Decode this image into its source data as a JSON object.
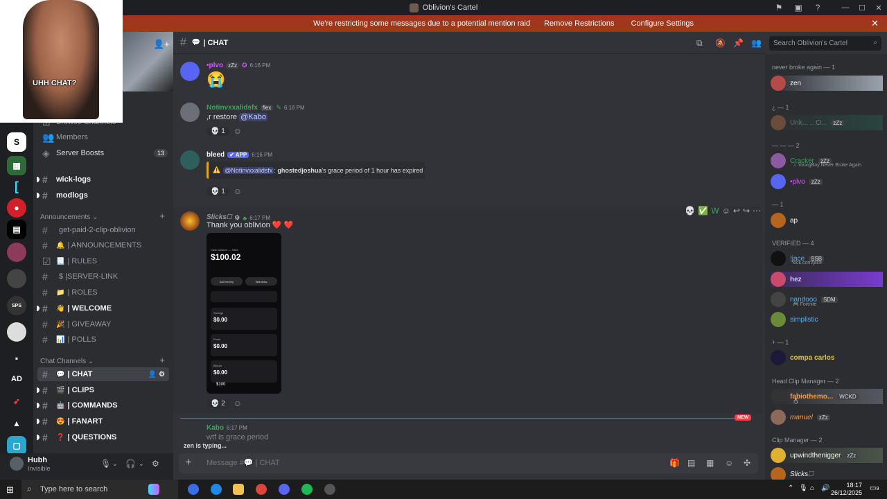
{
  "window": {
    "title": "Oblivion's Cartel"
  },
  "notice": {
    "text": "We're restricting some messages due to a potential mention raid",
    "remove_btn": "Remove Restrictions",
    "configure_btn": "Configure Settings"
  },
  "webcam": {
    "caption": "UHH CHAT?"
  },
  "sidebar": {
    "browse": "Browse Channels",
    "members": "Members",
    "boosts": "Server Boosts",
    "boosts_count": "13",
    "channels_top": [
      "wick-logs",
      "modlogs"
    ],
    "cat_announcements": "Announcements",
    "announcements": [
      {
        "icon": "",
        "label": "get-paid-2-clip-oblivion"
      },
      {
        "icon": "🔔",
        "label": "| ANNOUNCEMENTS"
      },
      {
        "icon": "📃",
        "label": "| RULES"
      },
      {
        "icon": "",
        "label": "$ |SERVER-LINK"
      },
      {
        "icon": "📁",
        "label": "| ROLES"
      },
      {
        "icon": "👋",
        "label": "| WELCOME"
      },
      {
        "icon": "🎉",
        "label": "| GIVEAWAY"
      },
      {
        "icon": "📊",
        "label": "| POLLS"
      }
    ],
    "cat_chat": "Chat Channels",
    "chat_channels": [
      {
        "icon": "💬",
        "label": "| CHAT"
      },
      {
        "icon": "🎬",
        "label": "| CLIPS"
      },
      {
        "icon": "🤖",
        "label": "| COMMANDS"
      },
      {
        "icon": "😍",
        "label": "| FANART"
      },
      {
        "icon": "❓",
        "label": "| QUESTIONS"
      }
    ]
  },
  "user": {
    "name": "Hubh",
    "status": "Invisible"
  },
  "chat": {
    "channel": "| CHAT",
    "search_placeholder": "Search Oblivion's Cartel",
    "composer_placeholder": "Message #💬 | CHAT",
    "typing": "zen is typing...",
    "new_label": "NEW",
    "messages": [
      {
        "author": "•plvo",
        "tag": "zZz",
        "time": "6:16 PM",
        "body": "😭",
        "author_color": "#d357fe"
      },
      {
        "author": "Notinvxxalidsfx",
        "tag": "flex",
        "time": "6:16 PM",
        "body_prefix": ",r restore ",
        "mention": "@Kabo",
        "reaction": "💀 1",
        "author_color": "#3ba55d"
      },
      {
        "author": "bleed",
        "app": "✔ APP",
        "time": "6:16 PM",
        "embed_icon": "⚠️",
        "embed_mention": "@Notinvxxalidsfx",
        "embed_text_a": ": ",
        "embed_user": "ghostedjoshua",
        "embed_text_b": "'s grace period of 1 hour has expired",
        "reaction": "💀 1",
        "author_color": "#f2f3f5"
      },
      {
        "author": "Slicks🗆",
        "time": "6:17 PM",
        "body": "Thank you oblivion ❤️ ❤️",
        "reaction": "💀 2",
        "author_color": "#949ba4"
      },
      {
        "author": "Kabo",
        "time": "6:17 PM",
        "body": "wtf is grace period",
        "author_color": "#3ba55d"
      }
    ],
    "phone": {
      "caption": "Cash balance — 9364",
      "balance": "$100.02",
      "add_money": "Add money",
      "withdraw": "Withdraw",
      "rows": [
        {
          "label": "Savings",
          "value": "$0.00"
        },
        {
          "label": "Pools",
          "value": "$0.00"
        },
        {
          "label": "Bitcoin",
          "value": "$0.00"
        }
      ],
      "footer": "$100"
    }
  },
  "members": {
    "groups": [
      {
        "title": "never broke again — 1"
      },
      {
        "title": "¿ — 1"
      },
      {
        "title": "— — — 2"
      },
      {
        "title": "— 1"
      },
      {
        "title": "VERIFIED — 4"
      },
      {
        "title": "+ — 1"
      },
      {
        "title": "Head Clip Manager — 2"
      },
      {
        "title": "Clip Manager — 2"
      }
    ],
    "list": [
      {
        "name": "zen",
        "color": "#f2f3f5"
      },
      {
        "name": "Unk... .. O...",
        "color": "#6d6f78"
      },
      {
        "name": "Cracker",
        "color": "#3ba55d",
        "sub": "♫ YoungBoy Never Broke Again"
      },
      {
        "name": "•plvo",
        "color": "#d357fe"
      },
      {
        "name": "ap",
        "color": "#f2f3f5"
      },
      {
        "name": "!jace",
        "color": "#5dadec",
        "sub": "kick.com/jace"
      },
      {
        "name": "hez",
        "color": "#c9cdfb"
      },
      {
        "name": "nandooo",
        "color": "#5dadec",
        "sub": "🎮 Fortnite"
      },
      {
        "name": "simplistic",
        "color": "#5dadec"
      },
      {
        "name": "compa carlos",
        "color": "#e7c24a"
      },
      {
        "name": "fabiothemo...",
        "color": "#f29a4a",
        "sub": "💍"
      },
      {
        "name": "manuel",
        "color": "#f29a4a"
      },
      {
        "name": "upwindthenigger",
        "color": "#f2f3f5"
      },
      {
        "name": "Slicks🗆",
        "color": "#f2f3f5"
      }
    ],
    "tags": {
      "wckd": "WCKD",
      "ssb": "SSB",
      "sdm": "SDM",
      "zzz": "zZz"
    }
  },
  "taskbar": {
    "search": "Type here to search",
    "time": "18:17",
    "date": "26/12/2025",
    "notif": "9"
  }
}
